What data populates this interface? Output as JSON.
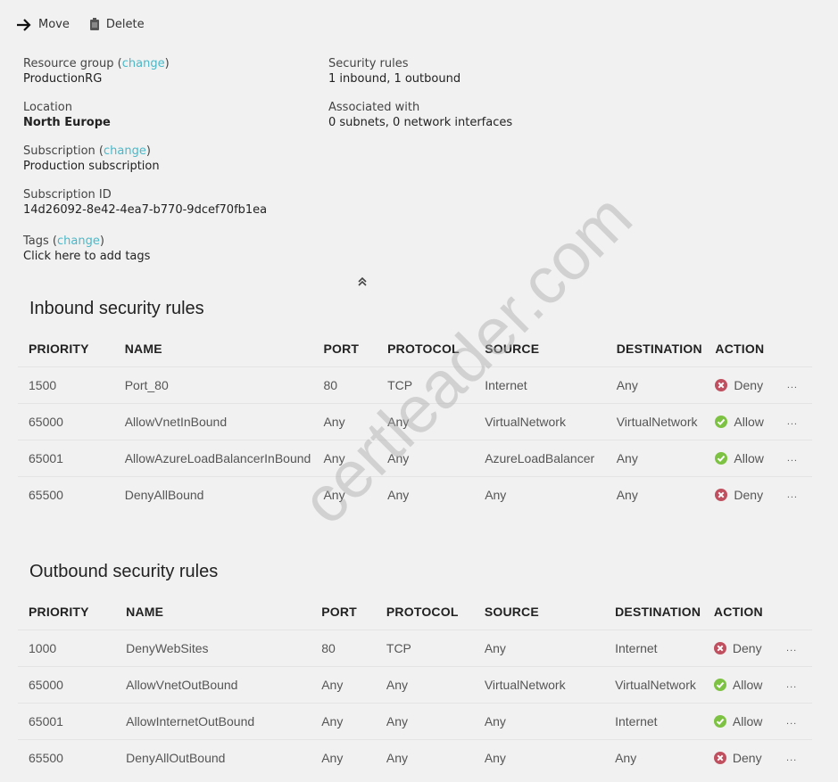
{
  "toolbar": {
    "move_label": "Move",
    "move_icon": "arrow-right-icon",
    "delete_label": "Delete",
    "delete_icon": "trash-icon"
  },
  "essentials": {
    "resource_group": {
      "label": "Resource group",
      "change": "change",
      "value": "ProductionRG"
    },
    "location": {
      "label": "Location",
      "value": "North Europe"
    },
    "subscription": {
      "label": "Subscription",
      "change": "change",
      "value": "Production subscription"
    },
    "subscription_id": {
      "label": "Subscription ID",
      "value": "14d26092-8e42-4ea7-b770-9dcef70fb1ea"
    },
    "tags": {
      "label": "Tags",
      "change": "change",
      "value": "Click here to add tags"
    },
    "security_rules": {
      "label": "Security rules",
      "value": "1 inbound, 1 outbound"
    },
    "associated_with": {
      "label": "Associated with",
      "value": "0 subnets, 0 network interfaces"
    },
    "collapse_icon": "double-chevron-up-icon"
  },
  "columns": [
    "PRIORITY",
    "NAME",
    "PORT",
    "PROTOCOL",
    "SOURCE",
    "DESTINATION",
    "ACTION"
  ],
  "colors": {
    "link": "#4ab8c8",
    "allow": "#7dc242",
    "deny": "#c0505f"
  },
  "inbound": {
    "title": "Inbound security rules",
    "rows": [
      {
        "priority": "1500",
        "name": "Port_80",
        "port": "80",
        "protocol": "TCP",
        "source": "Internet",
        "destination": "Any",
        "action": "Deny",
        "more": "..."
      },
      {
        "priority": "65000",
        "name": "AllowVnetInBound",
        "port": "Any",
        "protocol": "Any",
        "source": "VirtualNetwork",
        "destination": "VirtualNetwork",
        "action": "Allow",
        "more": "..."
      },
      {
        "priority": "65001",
        "name": "AllowAzureLoadBalancerInBound",
        "port": "Any",
        "protocol": "Any",
        "source": "AzureLoadBalancer",
        "destination": "Any",
        "action": "Allow",
        "more": "..."
      },
      {
        "priority": "65500",
        "name": "DenyAllBound",
        "port": "Any",
        "protocol": "Any",
        "source": "Any",
        "destination": "Any",
        "action": "Deny",
        "more": "..."
      }
    ]
  },
  "outbound": {
    "title": "Outbound security rules",
    "rows": [
      {
        "priority": "1000",
        "name": "DenyWebSites",
        "port": "80",
        "protocol": "TCP",
        "source": "Any",
        "destination": "Internet",
        "action": "Deny",
        "more": "..."
      },
      {
        "priority": "65000",
        "name": "AllowVnetOutBound",
        "port": "Any",
        "protocol": "Any",
        "source": "VirtualNetwork",
        "destination": "VirtualNetwork",
        "action": "Allow",
        "more": "..."
      },
      {
        "priority": "65001",
        "name": "AllowInternetOutBound",
        "port": "Any",
        "protocol": "Any",
        "source": "Any",
        "destination": "Internet",
        "action": "Allow",
        "more": "..."
      },
      {
        "priority": "65500",
        "name": "DenyAllOutBound",
        "port": "Any",
        "protocol": "Any",
        "source": "Any",
        "destination": "Any",
        "action": "Deny",
        "more": "..."
      }
    ]
  },
  "watermark": "certleader.com"
}
